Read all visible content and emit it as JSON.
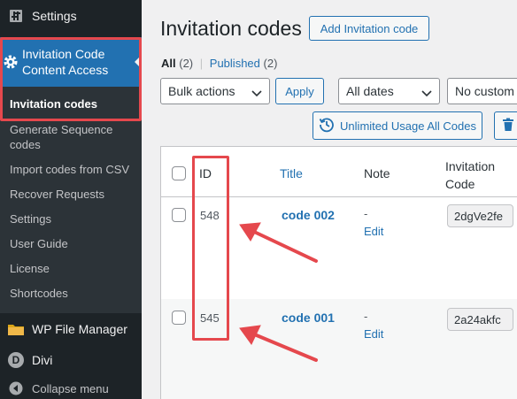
{
  "sidebar": {
    "settings_top": "Settings",
    "plugin_menu_label": "Invitation Code Content Access",
    "submenu": [
      {
        "label": "Invitation codes",
        "current": true
      },
      {
        "label": "Generate Sequence codes",
        "current": false
      },
      {
        "label": "Import codes from CSV",
        "current": false
      },
      {
        "label": "Recover Requests",
        "current": false
      },
      {
        "label": "Settings",
        "current": false
      },
      {
        "label": "User Guide",
        "current": false
      },
      {
        "label": "License",
        "current": false
      },
      {
        "label": "Shortcodes",
        "current": false
      }
    ],
    "wp_file_manager": "WP File Manager",
    "divi": "Divi",
    "divi_letter": "D",
    "collapse": "Collapse menu"
  },
  "page": {
    "title": "Invitation codes",
    "add_button": "Add Invitation code"
  },
  "views": {
    "all_label": "All",
    "all_count": "(2)",
    "separator": "|",
    "published_label": "Published",
    "published_count": "(2)"
  },
  "filters": {
    "bulk_actions": "Bulk actions",
    "apply": "Apply",
    "dates": "All dates",
    "custom": "No custom"
  },
  "toolbar": {
    "unlimited_button": "Unlimited Usage All Codes"
  },
  "table": {
    "headers": {
      "id": "ID",
      "title": "Title",
      "note": "Note",
      "code": "Invitation Code"
    },
    "rows": [
      {
        "id": "548",
        "title": "code 002",
        "note": "-",
        "edit": "Edit",
        "code": "2dgVe2fe"
      },
      {
        "id": "545",
        "title": "code 001",
        "note": "-",
        "edit": "Edit",
        "code": "2a24akfc"
      }
    ]
  },
  "colors": {
    "sidebar_bg": "#1d2327",
    "active_menu": "#2271b1",
    "highlight": "#e5484d",
    "link": "#2271b1"
  }
}
